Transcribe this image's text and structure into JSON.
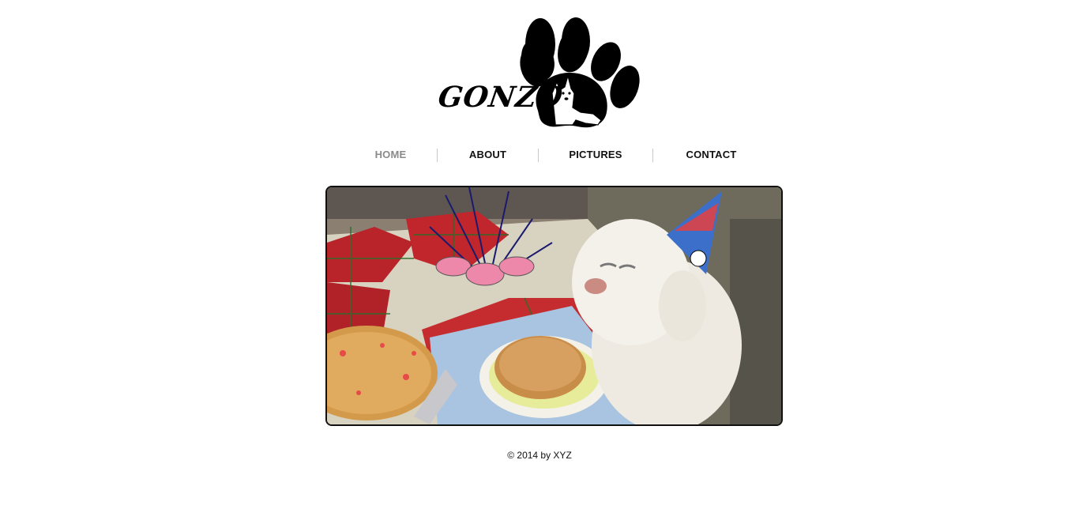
{
  "site": {
    "logo_text": "GONZO",
    "logo_icon": "paw-print-with-dog-icon"
  },
  "nav": {
    "items": [
      {
        "label": "HOME",
        "active": true
      },
      {
        "label": "ABOUT",
        "active": false
      },
      {
        "label": "PICTURES",
        "active": false
      },
      {
        "label": "CONTACT",
        "active": false
      }
    ]
  },
  "hero": {
    "image": "birthday-dog-photo"
  },
  "footer": {
    "copyright": "© 2014 by XYZ"
  },
  "colors": {
    "nav_active": "#8a8a8a",
    "nav_default": "#111111",
    "frame_border": "#111111"
  }
}
